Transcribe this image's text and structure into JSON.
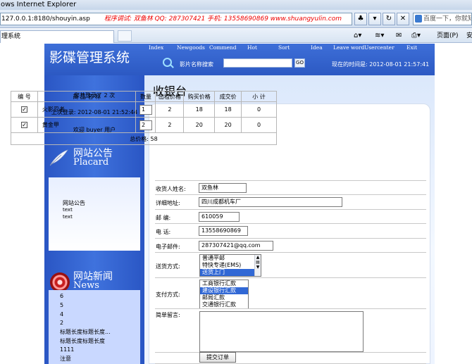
{
  "browser": {
    "window_title": "ows Internet Explorer",
    "address": "127.0.0.1:8180/shouyin.asp",
    "marquee": "程序调试: 双鱼林  QQ: 287307421  手机: 13558690869  www.shuangyulin.com",
    "search_placeholder": "百度一下，你就知",
    "tab_title": "理系统",
    "toolbar": {
      "page_label": "页面(P)",
      "safety_label": "安"
    }
  },
  "site": {
    "title": "影碟管理系统",
    "nav": [
      "Index",
      "Newgoods",
      "Commend",
      "Hot",
      "Sort",
      "Idea",
      "Leave word",
      "Usercenter",
      "Exit"
    ],
    "search_label": "影片名称搜索",
    "search_button": "GO",
    "time_text": "现在的时间是: 2012-08-01 21:57:41"
  },
  "sidebar": {
    "login_count": "您共登录了 2 次",
    "last_login": "上次登录: 2012-08-01 21:52:44",
    "welcome": "欢迎 buyer 用户",
    "notice": {
      "title_cn": "网站公告",
      "title_en": "Placard",
      "items": [
        "网站公告",
        "text",
        "text"
      ]
    },
    "news": {
      "title_cn": "网站新闻",
      "title_en": "News",
      "items": [
        "6",
        "5",
        "4",
        "2",
        "标题长度标题长度...",
        "标题长度标题长度",
        "1111",
        "注意"
      ]
    }
  },
  "main": {
    "title": "收银台",
    "cart": {
      "headers": [
        "编 号",
        "商 品 名 称",
        "数量",
        "出租价格",
        "购买价格",
        "成交价",
        "小 计"
      ],
      "rows": [
        {
          "check": "✓",
          "name": "火影忍者",
          "qty": "1",
          "rent": "2",
          "buy": "18",
          "deal": "18",
          "subtotal": "0"
        },
        {
          "check": "✓",
          "name": "黄金甲",
          "qty": "2",
          "rent": "2",
          "buy": "20",
          "deal": "20",
          "subtotal": "0"
        }
      ],
      "total": "总价格: 58"
    },
    "form": {
      "receiver_label": "收货人姓名:",
      "receiver": "双鱼林",
      "address_label": "详细地址:",
      "address": "四川成都机车厂",
      "postcode_label": "邮    编:",
      "postcode": "610059",
      "phone_label": "电    话:",
      "phone": "13558690869",
      "email_label": "电子邮件:",
      "email": "287307421@qq.com",
      "delivery_label": "送货方式:",
      "delivery_options": [
        "普通平邮",
        "特快专递(EMS)",
        "送货上门"
      ],
      "payment_label": "支付方式:",
      "payment_options": [
        "工商银行汇款",
        "建设银行汇款",
        "邮局汇款",
        "交通银行汇款"
      ],
      "note_label": "简单留言:",
      "submit": "提交订单"
    }
  }
}
